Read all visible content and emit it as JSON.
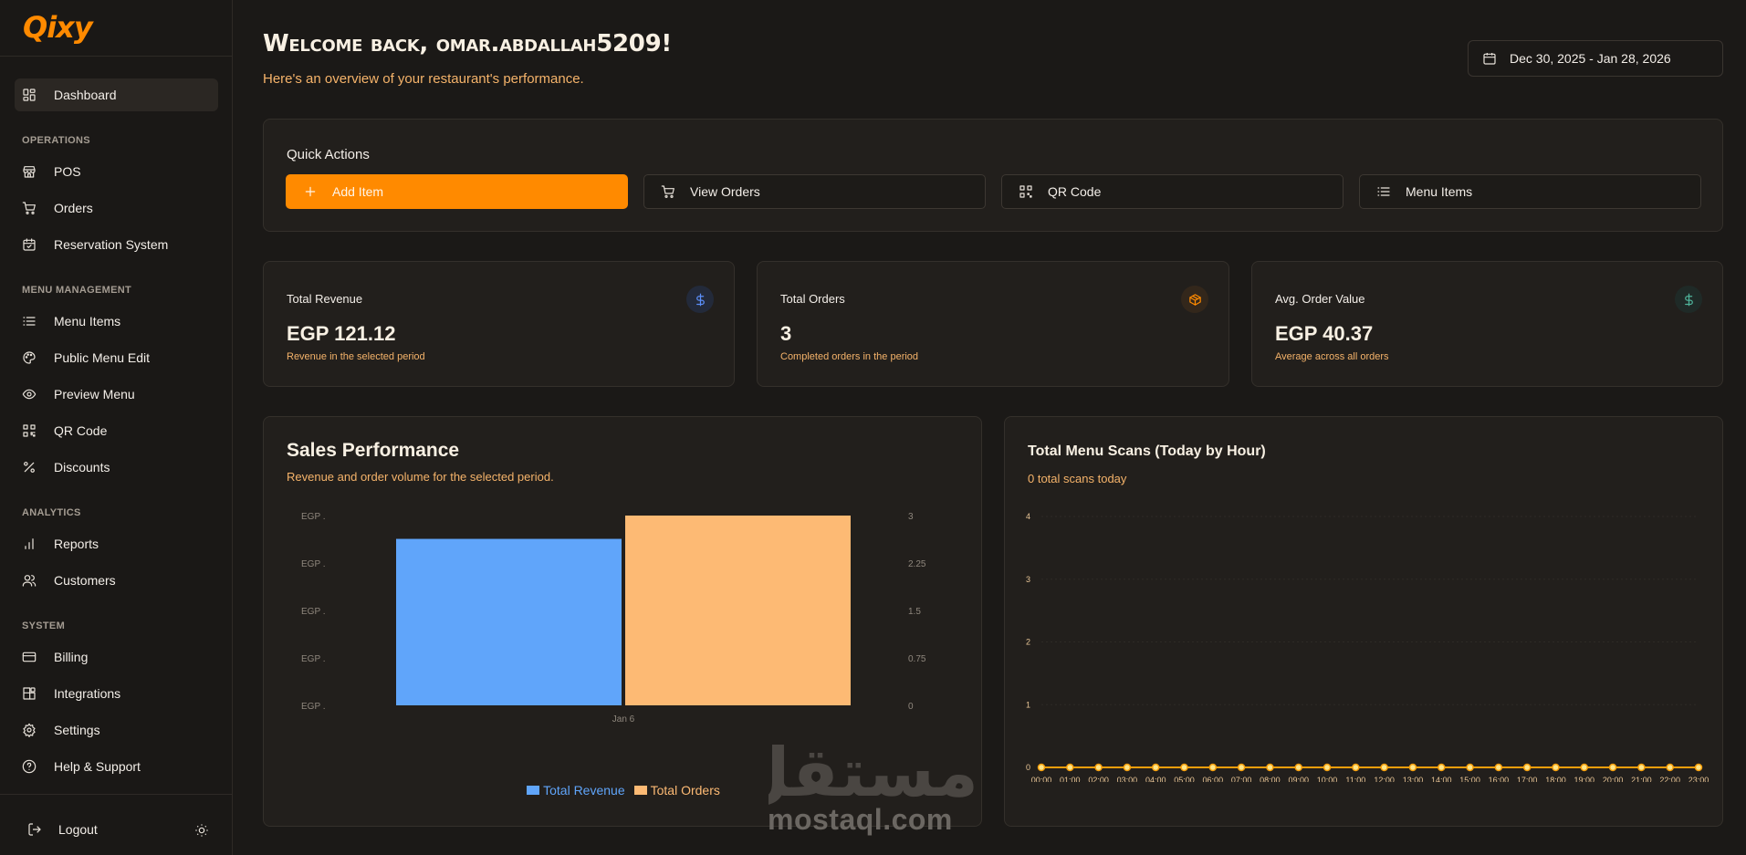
{
  "sidebar": {
    "logo_text": "Qixy",
    "dashboard_label": "Dashboard",
    "sections": {
      "operations": "OPERATIONS",
      "menu_management": "MENU MANAGEMENT",
      "analytics": "ANALYTICS",
      "system": "SYSTEM"
    },
    "items": {
      "pos": "POS",
      "orders": "Orders",
      "reservation": "Reservation System",
      "menu_items": "Menu Items",
      "public_menu_edit": "Public Menu Edit",
      "preview_menu": "Preview Menu",
      "qr_code": "QR Code",
      "discounts": "Discounts",
      "reports": "Reports",
      "customers": "Customers",
      "billing": "Billing",
      "integrations": "Integrations",
      "settings": "Settings",
      "help": "Help & Support"
    },
    "logout_label": "Logout"
  },
  "header": {
    "welcome": "Welcome back, omar.abdallah5209!",
    "subtitle": "Here's an overview of your restaurant's performance.",
    "date_range": "Dec 30, 2025 - Jan 28, 2026"
  },
  "quick_actions": {
    "title": "Quick Actions",
    "add_item": "Add Item",
    "view_orders": "View Orders",
    "qr_code": "QR Code",
    "menu_items": "Menu Items"
  },
  "stats": {
    "revenue": {
      "label": "Total Revenue",
      "value": "EGP 121.12",
      "note": "Revenue in the selected period",
      "color": "#5b8ff9"
    },
    "orders": {
      "label": "Total Orders",
      "value": "3",
      "note": "Completed orders in the period",
      "color": "#ff8a00"
    },
    "avg": {
      "label": "Avg. Order Value",
      "value": "EGP 40.37",
      "note": "Average across all orders",
      "color": "#4fb39a"
    }
  },
  "sales_chart": {
    "title": "Sales Performance",
    "subtitle": "Revenue and order volume for the selected period.",
    "legend_revenue": "Total Revenue",
    "legend_orders": "Total Orders",
    "revenue_color": "#60a5fa",
    "orders_color": "#fdba74"
  },
  "scans_chart": {
    "title": "Total Menu Scans (Today by Hour)",
    "subtitle": "0 total scans today",
    "line_color": "#f59e0b"
  },
  "watermark": {
    "arabic": "مستقل",
    "latin": "mostaql.com"
  },
  "chart_data": [
    {
      "type": "bar",
      "title": "Sales Performance",
      "categories": [
        "Jan 6"
      ],
      "series": [
        {
          "name": "Total Revenue",
          "values": [
            121.12
          ],
          "axis": "left"
        },
        {
          "name": "Total Orders",
          "values": [
            3
          ],
          "axis": "right"
        }
      ],
      "left_tick_labels": [
        "EGP .",
        "EGP .",
        "EGP .",
        "EGP .",
        "EGP ."
      ],
      "right_tick_labels": [
        "3",
        "2.25",
        "1.5",
        "0.75",
        "0"
      ],
      "right_ylim": [
        0,
        3
      ],
      "legend": "bottom"
    },
    {
      "type": "line",
      "title": "Total Menu Scans (Today by Hour)",
      "x": [
        "00:00",
        "01:00",
        "02:00",
        "03:00",
        "04:00",
        "05:00",
        "06:00",
        "07:00",
        "08:00",
        "09:00",
        "10:00",
        "11:00",
        "12:00",
        "13:00",
        "14:00",
        "15:00",
        "16:00",
        "17:00",
        "18:00",
        "19:00",
        "20:00",
        "21:00",
        "22:00",
        "23:00"
      ],
      "y": [
        0,
        0,
        0,
        0,
        0,
        0,
        0,
        0,
        0,
        0,
        0,
        0,
        0,
        0,
        0,
        0,
        0,
        0,
        0,
        0,
        0,
        0,
        0,
        0
      ],
      "y_ticks": [
        "4",
        "3",
        "2",
        "1",
        "0"
      ],
      "ylim": [
        0,
        4
      ],
      "grid": true
    }
  ]
}
